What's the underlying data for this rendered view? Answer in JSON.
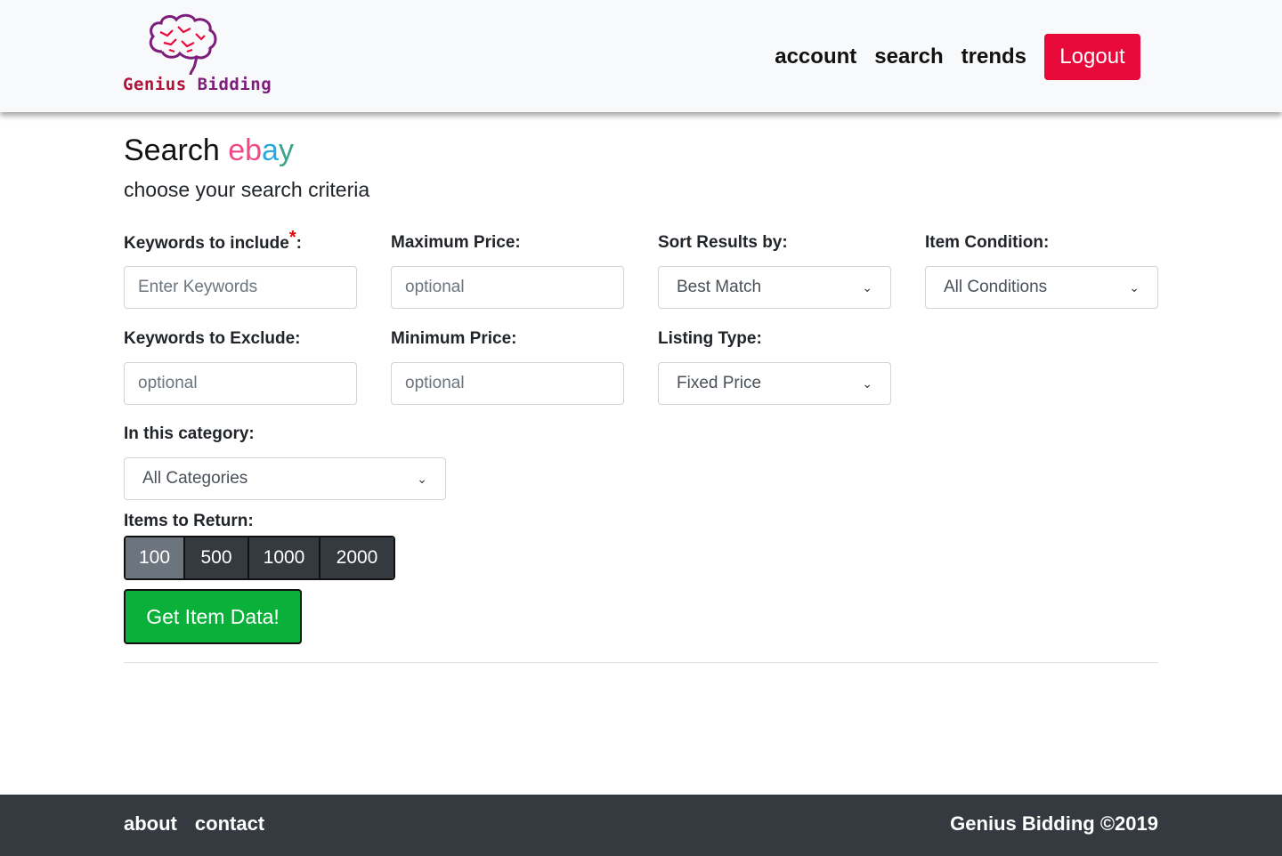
{
  "brand": {
    "name_part1": "Genius",
    "name_part2": "Bidding",
    "logo_icon": "brain-icon"
  },
  "nav": {
    "links": [
      "account",
      "search",
      "trends"
    ],
    "logout_label": "Logout"
  },
  "page": {
    "title_prefix": "Search",
    "title_brand": [
      "e",
      "b",
      "a",
      "y"
    ],
    "subtitle": "choose your search criteria"
  },
  "form": {
    "keywords_include": {
      "label": "Keywords to include",
      "required_mark": "*",
      "suffix": ":",
      "placeholder": "Enter Keywords"
    },
    "max_price": {
      "label": "Maximum Price:",
      "placeholder": "optional"
    },
    "sort_by": {
      "label": "Sort Results by:",
      "value": "Best Match"
    },
    "condition": {
      "label": "Item Condition:",
      "value": "All Conditions"
    },
    "keywords_exclude": {
      "label": "Keywords to Exclude:",
      "placeholder": "optional"
    },
    "min_price": {
      "label": "Minimum Price:",
      "placeholder": "optional"
    },
    "listing_type": {
      "label": "Listing Type:",
      "value": "Fixed Price"
    },
    "category": {
      "label": "In this category:",
      "value": "All Categories"
    },
    "items_to_return": {
      "label": "Items to Return:",
      "options": [
        "100",
        "500",
        "1000",
        "2000"
      ],
      "selected": "100"
    },
    "submit_label": "Get Item Data!"
  },
  "footer": {
    "links": [
      "about",
      "contact"
    ],
    "copyright": "Genius Bidding ©2019"
  },
  "colors": {
    "logout": "#e8083a",
    "submit": "#0ab039",
    "footer_bg": "#343a40",
    "navbar_bg": "#f8f9fa"
  }
}
